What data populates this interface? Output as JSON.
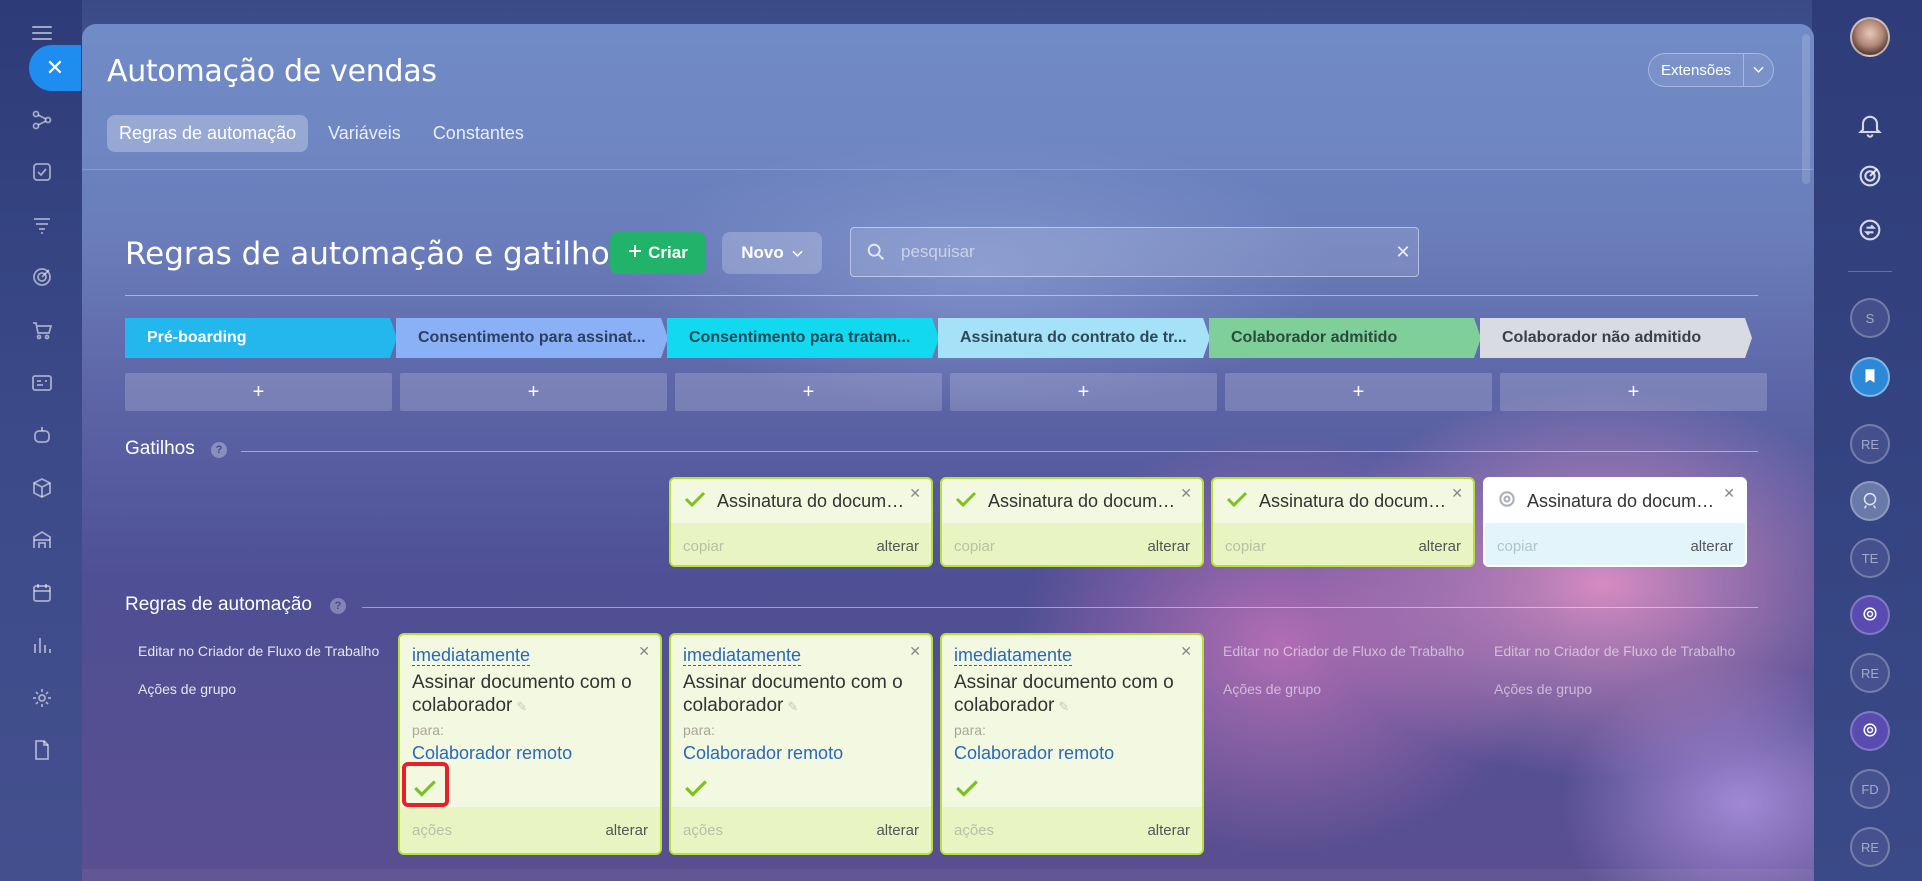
{
  "page": {
    "title": "Automação de vendas",
    "extensions_label": "Extensões",
    "tabs": [
      {
        "label": "Regras de automação",
        "active": true
      },
      {
        "label": "Variáveis",
        "active": false
      },
      {
        "label": "Constantes",
        "active": false
      }
    ]
  },
  "toolbar": {
    "heading": "Regras de automação e gatilhos",
    "create_label": "Criar",
    "new_label": "Novo",
    "search_placeholder": "pesquisar"
  },
  "stages": [
    {
      "label": "Pré-boarding",
      "color": "#23b7ee",
      "text_color": "#ffffff"
    },
    {
      "label": "Consentimento para assinat...",
      "color": "#8ab0f5",
      "text_color": "#2c3e62"
    },
    {
      "label": "Consentimento para tratam...",
      "color": "#12d8f0",
      "text_color": "#1a4a55"
    },
    {
      "label": "Assinatura do contrato de tr...",
      "color": "#a6e2f7",
      "text_color": "#2c4a5a"
    },
    {
      "label": "Colaborador admitido",
      "color": "#7fcf9a",
      "text_color": "#2a4a3a"
    },
    {
      "label": "Colaborador não admitido",
      "color": "#d8dce2",
      "text_color": "#3a3f48"
    }
  ],
  "add_symbol": "+",
  "sections": {
    "triggers_label": "Gatilhos",
    "rules_label": "Regras de automação"
  },
  "triggers": [
    {
      "title": "Assinatura do docume...",
      "copy": "copiar",
      "edit": "alterar",
      "status": "check"
    },
    {
      "title": "Assinatura do docume...",
      "copy": "copiar",
      "edit": "alterar",
      "status": "check"
    },
    {
      "title": "Assinatura do docume...",
      "copy": "copiar",
      "edit": "alterar",
      "status": "check"
    },
    {
      "title": "Assinatura do documen...",
      "copy": "copiar",
      "edit": "alterar",
      "status": "pending"
    }
  ],
  "rule_side_links": {
    "edit_workflow": "Editar no Criador de Fluxo de Trabalho",
    "group_actions": "Ações de grupo"
  },
  "rules": [
    {
      "when": "imediatamente",
      "desc": "Assinar documento com o colaborador",
      "para": "para:",
      "who": "Colaborador remoto",
      "actions": "ações",
      "edit": "alterar"
    },
    {
      "when": "imediatamente",
      "desc": "Assinar documento com o colaborador",
      "para": "para:",
      "who": "Colaborador remoto",
      "actions": "ações",
      "edit": "alterar"
    },
    {
      "when": "imediatamente",
      "desc": "Assinar documento com o colaborador",
      "para": "para:",
      "who": "Colaborador remoto",
      "actions": "ações",
      "edit": "alterar"
    }
  ],
  "right_sidebar": {
    "circles": [
      "S",
      "",
      "RE",
      "",
      "TE",
      "",
      "RE",
      "",
      "FD",
      "RE"
    ]
  },
  "colors": {
    "accent": "#1f8cf0",
    "create_button": "#22b36a",
    "card_border": "#b8e03a",
    "check": "#7cc21e",
    "highlight": "#e8202a",
    "link": "#2a68b8"
  }
}
